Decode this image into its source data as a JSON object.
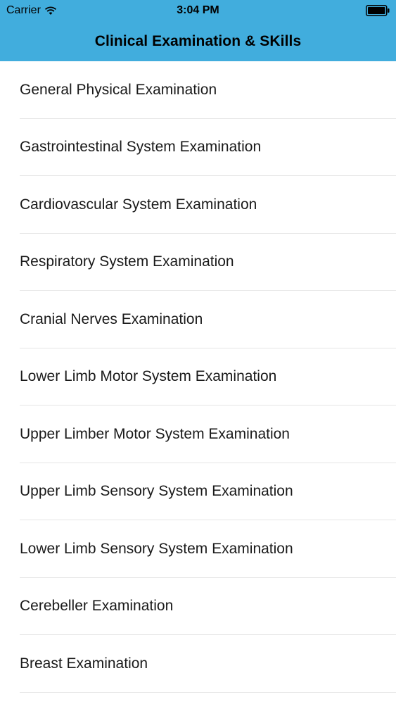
{
  "status_bar": {
    "carrier": "Carrier",
    "time": "3:04 PM",
    "wifi_icon": "wifi-icon",
    "battery_icon": "battery-icon"
  },
  "nav_bar": {
    "title": "Clinical Examination & SKills",
    "background_color": "#41addd"
  },
  "list": {
    "items": [
      {
        "label": "General Physical Examination"
      },
      {
        "label": "Gastrointestinal System Examination"
      },
      {
        "label": "Cardiovascular System Examination"
      },
      {
        "label": "Respiratory System Examination"
      },
      {
        "label": "Cranial Nerves Examination"
      },
      {
        "label": "Lower Limb Motor System Examination"
      },
      {
        "label": "Upper Limber Motor System Examination"
      },
      {
        "label": "Upper Limb Sensory System Examination"
      },
      {
        "label": "Lower Limb Sensory System Examination"
      },
      {
        "label": "Cerebeller Examination"
      },
      {
        "label": "Breast Examination"
      }
    ]
  }
}
